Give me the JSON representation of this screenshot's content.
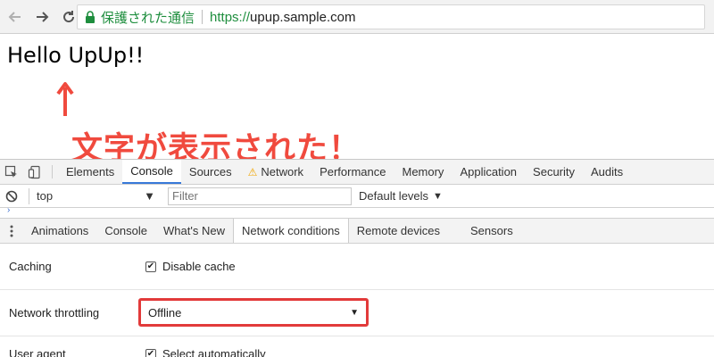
{
  "browser": {
    "secure_label": "保護された通信",
    "url_scheme": "https://",
    "url_rest": "upup.sample.com"
  },
  "page": {
    "heading": "Hello UpUp!!",
    "annotation": "文字が表示された！"
  },
  "devtools": {
    "tabs": [
      "Elements",
      "Console",
      "Sources",
      "Network",
      "Performance",
      "Memory",
      "Application",
      "Security",
      "Audits"
    ],
    "active_tab": "Console",
    "console": {
      "context": "top",
      "filter_placeholder": "Filter",
      "levels": "Default levels"
    },
    "drawer_tabs": [
      "Animations",
      "Console",
      "What's New",
      "Network conditions",
      "Remote devices",
      "Sensors"
    ],
    "active_drawer_tab": "Network conditions",
    "network_conditions": {
      "caching_label": "Caching",
      "disable_cache_label": "Disable cache",
      "disable_cache_checked": true,
      "throttling_label": "Network throttling",
      "throttling_value": "Offline",
      "user_agent_label": "User agent",
      "select_auto_label": "Select automatically",
      "select_auto_checked": true
    }
  },
  "colors": {
    "secure_green": "#1e8e3e",
    "annotation_red": "#f04a3e",
    "highlight_red": "#e23a3a",
    "active_tab_blue": "#3879d9"
  }
}
